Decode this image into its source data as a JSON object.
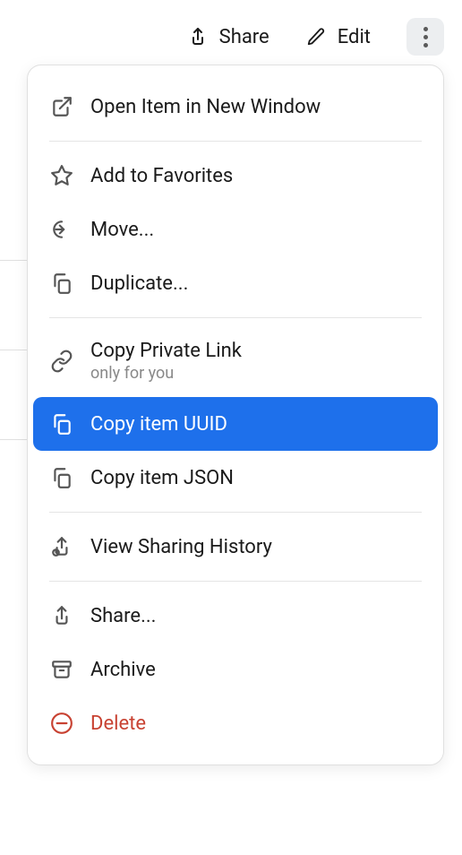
{
  "toolbar": {
    "share_label": "Share",
    "edit_label": "Edit"
  },
  "menu": {
    "open_new_window": "Open Item in New Window",
    "add_favorites": "Add to Favorites",
    "move": "Move...",
    "duplicate": "Duplicate...",
    "copy_private_link": "Copy Private Link",
    "copy_private_link_sub": "only for you",
    "copy_uuid": "Copy item UUID",
    "copy_json": "Copy item JSON",
    "view_sharing_history": "View Sharing History",
    "share": "Share...",
    "archive": "Archive",
    "delete": "Delete"
  },
  "colors": {
    "selected_bg": "#1e70eb",
    "danger": "#c84232"
  }
}
